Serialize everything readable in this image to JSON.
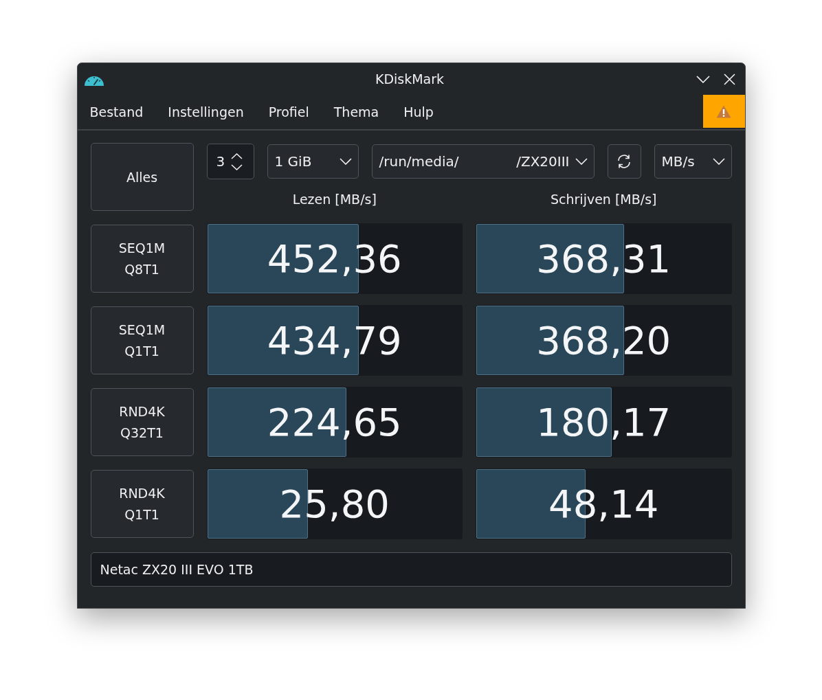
{
  "window": {
    "title": "KDiskMark"
  },
  "menu": [
    "Bestand",
    "Instellingen",
    "Profiel",
    "Thema",
    "Hulp"
  ],
  "toolbar": {
    "all_button": "Alles",
    "runs": "3",
    "size": "1 GiB",
    "directory": {
      "start": "/run/media/",
      "end": "/ZX20III"
    },
    "unit": "MB/s"
  },
  "headers": {
    "read": "Lezen [MB/s]",
    "write": "Schrijven [MB/s]"
  },
  "tests": [
    {
      "name": "SEQ1M",
      "params": "Q8T1",
      "read": {
        "value": "452,36",
        "level": 0.594
      },
      "write": {
        "value": "368,31",
        "level": 0.579
      }
    },
    {
      "name": "SEQ1M",
      "params": "Q1T1",
      "read": {
        "value": "434,79",
        "level": 0.594
      },
      "write": {
        "value": "368,20",
        "level": 0.579
      }
    },
    {
      "name": "RND4K",
      "params": "Q32T1",
      "read": {
        "value": "224,65",
        "level": 0.546
      },
      "write": {
        "value": "180,17",
        "level": 0.531
      }
    },
    {
      "name": "RND4K",
      "params": "Q1T1",
      "read": {
        "value": "25,80",
        "level": 0.395
      },
      "write": {
        "value": "48,14",
        "level": 0.429
      }
    }
  ],
  "comment": "Netac ZX20 III EVO 1TB"
}
